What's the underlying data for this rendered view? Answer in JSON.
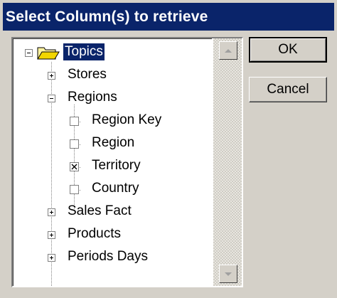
{
  "window": {
    "title": "Select Column(s) to retrieve"
  },
  "tree": {
    "root": {
      "label": "Topics",
      "expanded": true,
      "selected": true,
      "icon": "open-folder-icon"
    },
    "items": [
      {
        "label": "Stores",
        "expanded": false
      },
      {
        "label": "Regions",
        "expanded": true,
        "children": [
          {
            "label": "Region Key",
            "checked": false
          },
          {
            "label": "Region",
            "checked": false
          },
          {
            "label": "Territory",
            "checked": true
          },
          {
            "label": "Country",
            "checked": false
          }
        ]
      },
      {
        "label": "Sales Fact",
        "expanded": false
      },
      {
        "label": "Products",
        "expanded": false
      },
      {
        "label": "Periods Days",
        "expanded": false
      }
    ]
  },
  "buttons": {
    "ok_label": "OK",
    "cancel_label": "Cancel"
  },
  "colors": {
    "title_bar": "#0a246a",
    "face": "#d4d0c8",
    "selection": "#0a246a"
  }
}
